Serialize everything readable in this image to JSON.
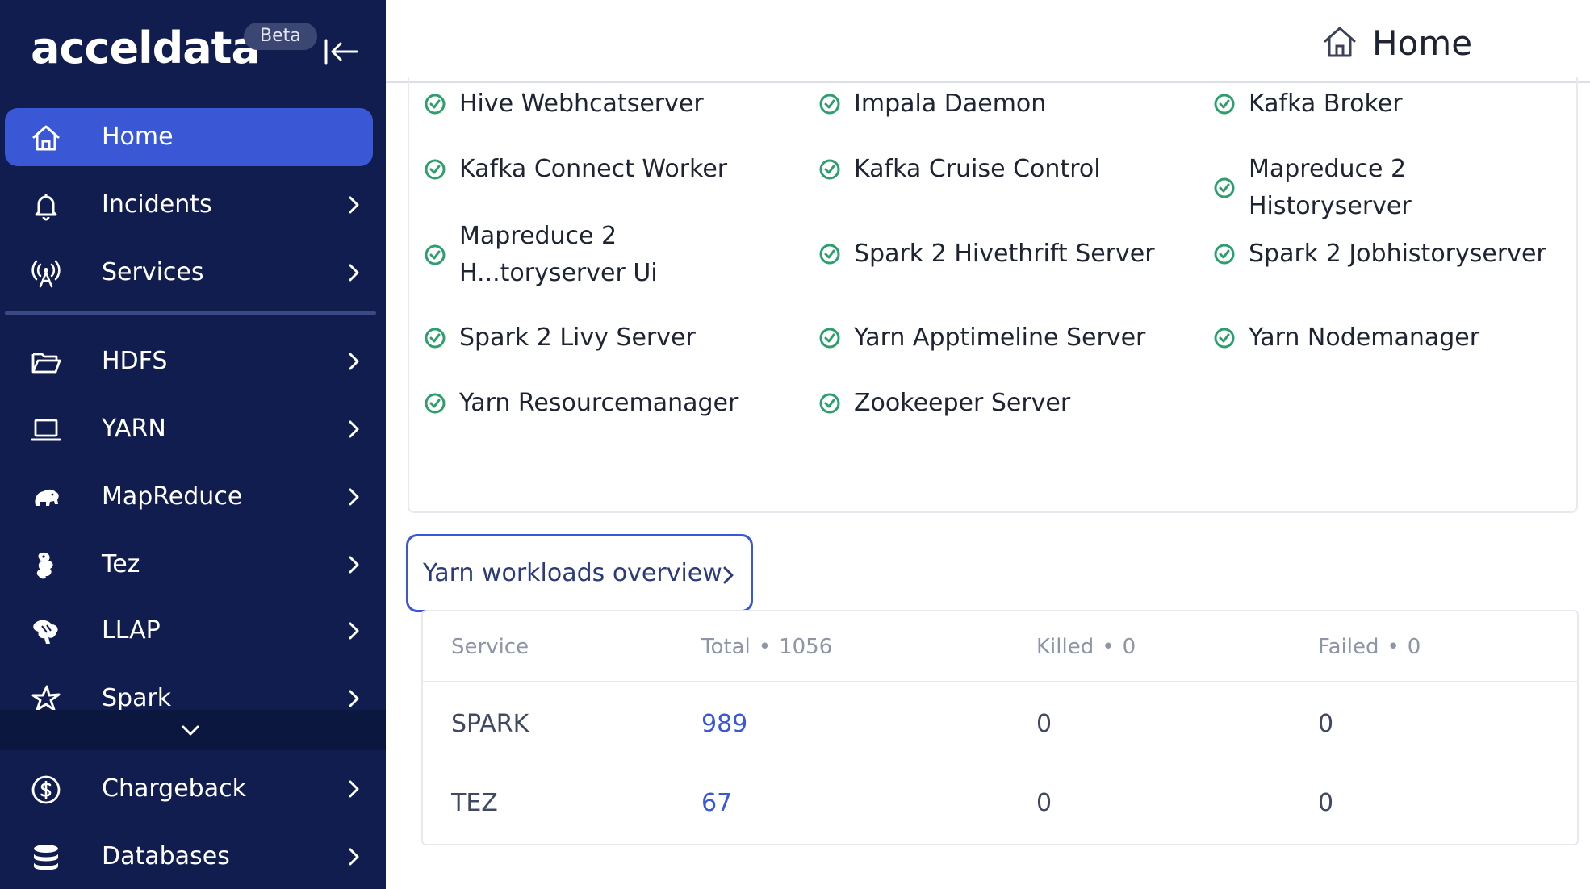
{
  "brand": {
    "logo_text": "acceldata",
    "badge": "Beta"
  },
  "sidebar": {
    "items": [
      {
        "label": "Home",
        "icon": "home-icon",
        "active": true
      },
      {
        "label": "Incidents",
        "icon": "bell-icon"
      },
      {
        "label": "Services",
        "icon": "antenna-icon"
      },
      {
        "label": "HDFS",
        "icon": "folder-icon"
      },
      {
        "label": "YARN",
        "icon": "laptop-icon"
      },
      {
        "label": "MapReduce",
        "icon": "elephant-icon"
      },
      {
        "label": "Tez",
        "icon": "tez-icon"
      },
      {
        "label": "LLAP",
        "icon": "bee-icon"
      },
      {
        "label": "Spark",
        "icon": "star-icon"
      },
      {
        "label": "Chargeback",
        "icon": "dollar-icon"
      },
      {
        "label": "Databases",
        "icon": "database-icon"
      }
    ]
  },
  "header": {
    "title": "Home"
  },
  "services": [
    "Hive Webhcatserver",
    "Impala Daemon",
    "Kafka Broker",
    "Kafka Connect Worker",
    "Kafka Cruise Control",
    "Mapreduce 2 Historyserver",
    "Mapreduce 2 H...toryserver Ui",
    "Spark 2 Hivethrift Server",
    "Spark 2 Jobhistoryserver",
    "Spark 2 Livy Server",
    "Yarn Apptimeline Server",
    "Yarn Nodemanager",
    "Yarn Resourcemanager",
    "Zookeeper Server"
  ],
  "colors": {
    "sidebar_bg": "#111d4f",
    "accent": "#3a57d6",
    "ok": "#2f9e6e"
  },
  "yarn": {
    "button_label": "Yarn workloads overview",
    "headers": {
      "service": "Service",
      "total_label": "Total",
      "total_value": "1056",
      "killed_label": "Killed",
      "killed_value": "0",
      "failed_label": "Failed",
      "failed_value": "0",
      "dot": "•"
    },
    "rows": [
      {
        "service": "SPARK",
        "total": "989",
        "killed": "0",
        "failed": "0"
      },
      {
        "service": "TEZ",
        "total": "67",
        "killed": "0",
        "failed": "0"
      }
    ]
  }
}
